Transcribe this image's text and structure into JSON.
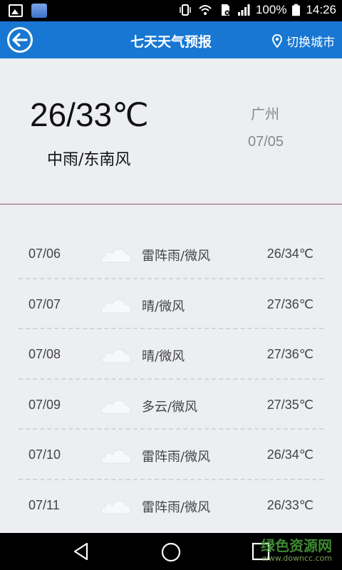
{
  "status_bar": {
    "battery": "100%",
    "time": "14:26"
  },
  "header": {
    "title": "七天天气预报",
    "switch_city": "切换城市"
  },
  "current": {
    "temp_range": "26/33℃",
    "description": "中雨/东南风",
    "city": "广州",
    "date": "07/05"
  },
  "forecast": [
    {
      "date": "07/06",
      "condition": "雷阵雨/微风",
      "temp": "26/34℃",
      "icon": "cloud-icon"
    },
    {
      "date": "07/07",
      "condition": "晴/微风",
      "temp": "27/36℃",
      "icon": "cloud-icon"
    },
    {
      "date": "07/08",
      "condition": "晴/微风",
      "temp": "27/36℃",
      "icon": "cloud-icon"
    },
    {
      "date": "07/09",
      "condition": "多云/微风",
      "temp": "27/35℃",
      "icon": "cloud-icon"
    },
    {
      "date": "07/10",
      "condition": "雷阵雨/微风",
      "temp": "26/34℃",
      "icon": "cloud-icon"
    },
    {
      "date": "07/11",
      "condition": "雷阵雨/微风",
      "temp": "26/33℃",
      "icon": "cloud-icon"
    }
  ],
  "watermark": {
    "name": "绿色资源网",
    "url": "www.downcc.com"
  },
  "colors": {
    "header_bg": "#1777d2",
    "page_bg": "#eceef2",
    "divider": "#8b5a6a"
  }
}
